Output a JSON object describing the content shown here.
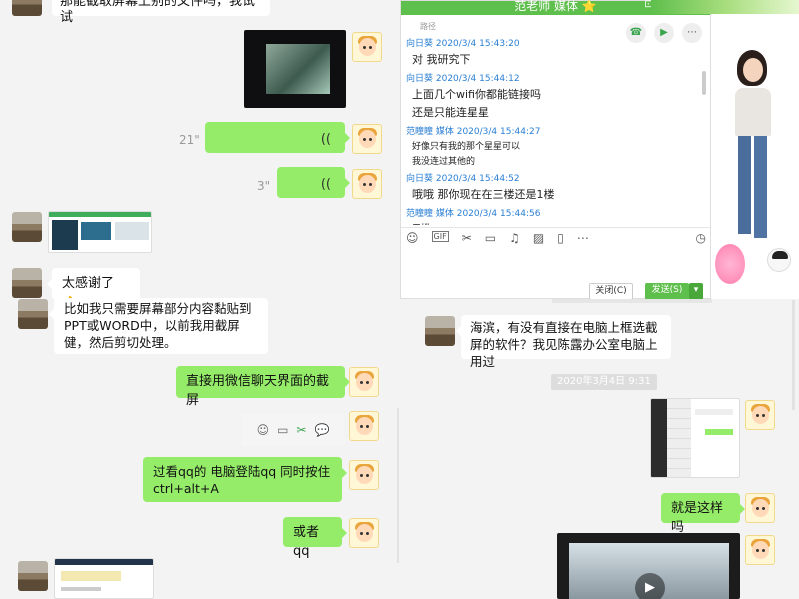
{
  "colors": {
    "wechat_green": "#95ec69",
    "qq_green": "#5fbf4c",
    "link_blue": "#2a7fd4"
  },
  "top_left": {
    "partial_message": "那能截取屏幕上别的文件吗，我试试"
  },
  "voice_messages": [
    {
      "duration": "21\""
    },
    {
      "duration": "3\""
    }
  ],
  "left_chat": {
    "thanks": "太感谢了👌",
    "question": "比如我只需要屏幕部分内容黏贴到PPT或WORD中，以前我用截屏健，然后剪切处理。",
    "answer1": "直接用微信聊天界面的截屏",
    "answer2": "过看qq的  电脑登陆qq  同时按住ctrl+alt+A",
    "answer3": "或者qq"
  },
  "qq_window": {
    "title": "范老师 媒体 ⭐",
    "messages": [
      {
        "meta": "",
        "text": "路径"
      },
      {
        "meta": "向日葵 2020/3/4 15:43:20",
        "text": "对 我研究下"
      },
      {
        "meta": "向日葵 2020/3/4 15:44:12",
        "text": "上面几个wifi你都能链接吗"
      },
      {
        "meta": "",
        "text": "还是只能连星星"
      },
      {
        "meta": "范瞳瞳 媒体 2020/3/4 15:44:27",
        "text": "好像只有我的那个星星可以"
      },
      {
        "meta": "",
        "text": "我没连过其他的"
      },
      {
        "meta": "向日葵 2020/3/4 15:44:52",
        "text": "哦哦 那你现在在三楼还是1楼"
      },
      {
        "meta": "范瞳瞳 媒体 2020/3/4 15:44:56",
        "text": "三楼"
      }
    ],
    "close_btn": "关闭(C)",
    "send_btn": "发送(S)"
  },
  "right_chat": {
    "message": "海滨，有没有直接在电脑上框选截屏的软件？我见陈露办公室电脑上用过",
    "timestamp": "2020年3月4日 9:31",
    "reply": "就是这样吗"
  }
}
